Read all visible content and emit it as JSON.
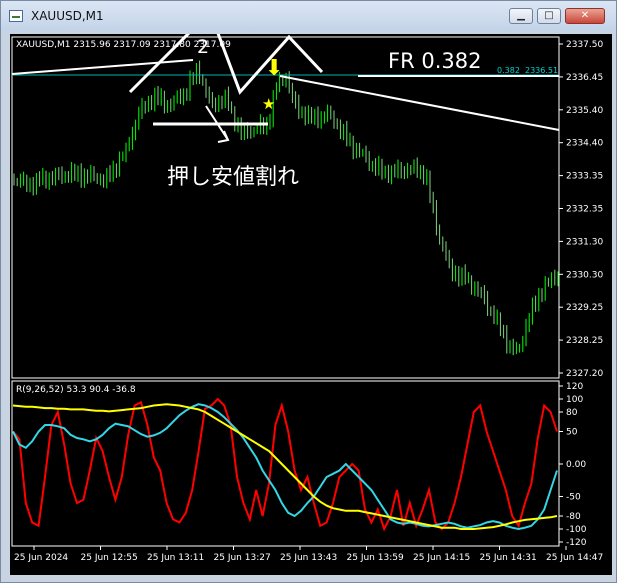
{
  "window": {
    "title": "XAUUSD,M1",
    "minimize_glyph": "▁",
    "maximize_glyph": "□",
    "close_glyph": "✕"
  },
  "chart_data": [
    {
      "type": "line",
      "series_kind": "candlestick-like price bars",
      "info": "XAUUSD,M1  2315.96 2317.09 2317.80 2317.09",
      "ylim": [
        2327.2,
        2337.5
      ],
      "yticks": [
        "2337.50",
        "2336.45",
        "2335.40",
        "2334.40",
        "2333.35",
        "2332.35",
        "2331.30",
        "2330.30",
        "2329.25",
        "2328.25",
        "2327.20"
      ],
      "price_tag": "2336.51",
      "fib_tag": "0.382",
      "fib_level": 2336.51,
      "annotations": {
        "fr_label": "FR 0.382",
        "wave_label": "2",
        "jp_label": "押し安値割れ",
        "star": "★",
        "arrow": "⬇"
      },
      "colors": {
        "up": "#00ff00",
        "down": "#7fd37f",
        "fib": "#00c0c0",
        "annot": "#ffffff",
        "marker": "#ffff00"
      },
      "x": [
        "25 Jun 2024",
        "25 Jun 12:55",
        "25 Jun 13:11",
        "25 Jun 13:27",
        "25 Jun 13:43",
        "25 Jun 13:59",
        "25 Jun 14:15",
        "25 Jun 14:31",
        "25 Jun 14:47"
      ]
    },
    {
      "type": "line",
      "info": "R(9,26,52) 53.3 90.4 -36.8",
      "ylim": [
        -120,
        120
      ],
      "yticks": [
        "120",
        "100",
        "80",
        "50",
        "0.00",
        "-50",
        "-80",
        "-100",
        "-120"
      ],
      "series": [
        {
          "color": "#ff0000",
          "values": [
            50,
            38,
            -60,
            -90,
            -95,
            -20,
            60,
            80,
            30,
            -30,
            -60,
            -55,
            -10,
            40,
            20,
            -20,
            -55,
            -20,
            45,
            90,
            95,
            60,
            10,
            -10,
            -60,
            -85,
            -90,
            -75,
            -40,
            20,
            85,
            90,
            100,
            90,
            60,
            -20,
            -60,
            -85,
            -40,
            -80,
            -30,
            60,
            90,
            50,
            -10,
            -40,
            -20,
            -60,
            -95,
            -90,
            -60,
            -20,
            -10,
            0,
            -10,
            -70,
            -90,
            -70,
            -100,
            -80,
            -40,
            -95,
            -60,
            -95,
            -70,
            -40,
            -90,
            -100,
            -90,
            -60,
            -20,
            30,
            80,
            90,
            50,
            20,
            -10,
            -40,
            -80,
            -95,
            -60,
            -30,
            40,
            90,
            80,
            50
          ]
        },
        {
          "color": "#33d6e6",
          "values": [
            50,
            30,
            25,
            35,
            50,
            60,
            60,
            58,
            55,
            45,
            40,
            38,
            35,
            38,
            45,
            55,
            62,
            60,
            58,
            52,
            46,
            42,
            44,
            48,
            55,
            65,
            75,
            82,
            88,
            92,
            90,
            86,
            80,
            72,
            62,
            52,
            40,
            25,
            10,
            -10,
            -25,
            -40,
            -60,
            -75,
            -80,
            -72,
            -60,
            -50,
            -35,
            -20,
            -15,
            -10,
            0,
            -10,
            -20,
            -30,
            -40,
            -55,
            -70,
            -85,
            -90,
            -92,
            -90,
            -92,
            -95,
            -96,
            -94,
            -92,
            -90,
            -92,
            -96,
            -98,
            -96,
            -94,
            -90,
            -88,
            -90,
            -95,
            -98,
            -100,
            -98,
            -95,
            -85,
            -70,
            -40,
            -10
          ]
        },
        {
          "color": "#ffff00",
          "values": [
            90,
            89,
            88,
            88,
            87,
            86,
            86,
            85,
            85,
            84,
            84,
            84,
            83,
            82,
            82,
            81,
            82,
            83,
            84,
            85,
            86,
            88,
            90,
            91,
            92,
            91,
            90,
            88,
            86,
            84,
            80,
            74,
            68,
            62,
            56,
            50,
            44,
            38,
            32,
            26,
            20,
            10,
            0,
            -10,
            -20,
            -30,
            -40,
            -50,
            -58,
            -64,
            -68,
            -70,
            -72,
            -72,
            -72,
            -74,
            -76,
            -78,
            -80,
            -82,
            -84,
            -86,
            -88,
            -90,
            -92,
            -94,
            -96,
            -98,
            -98,
            -98,
            -100,
            -100,
            -100,
            -99,
            -98,
            -97,
            -95,
            -93,
            -90,
            -88,
            -86,
            -85,
            -84,
            -83,
            -82,
            -80
          ]
        }
      ]
    }
  ]
}
